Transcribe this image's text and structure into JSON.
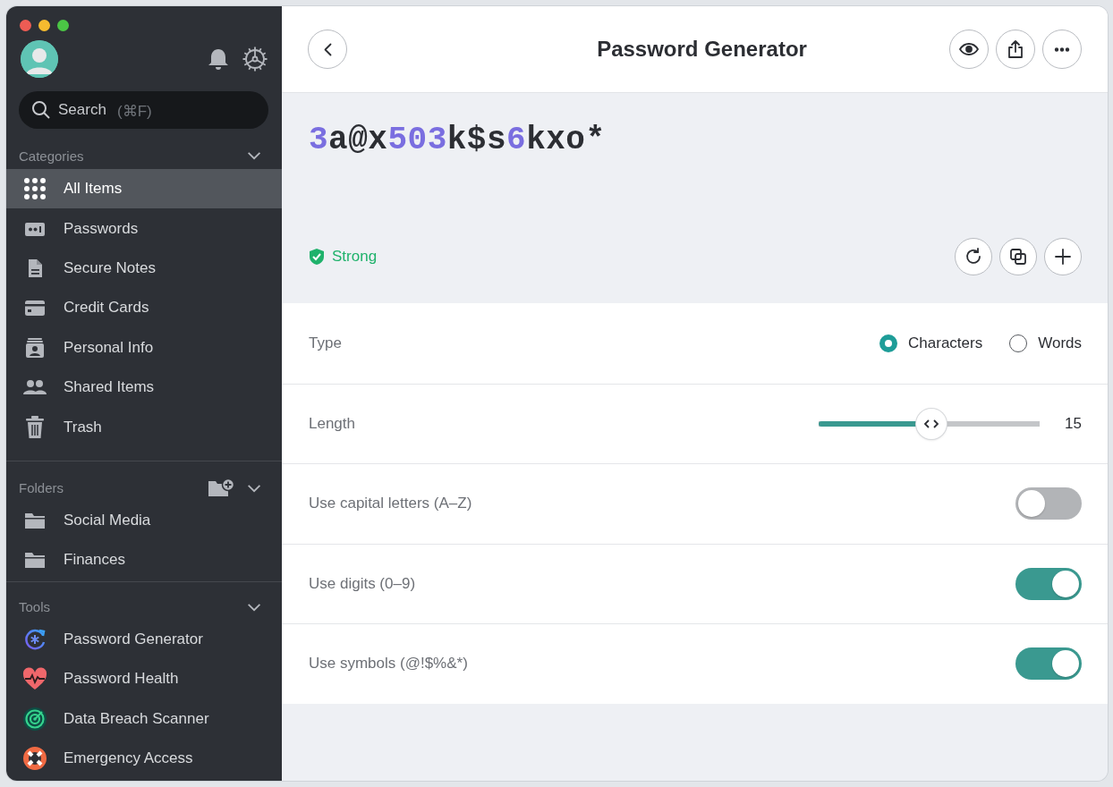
{
  "sidebar": {
    "search": {
      "placeholder": "Search",
      "shortcut": "(⌘F)"
    },
    "sections": [
      {
        "title": "Categories",
        "expanded": true,
        "add_button": false,
        "items": [
          {
            "label": "All Items",
            "kind": "grid",
            "selected": true
          },
          {
            "label": "Passwords",
            "kind": "password",
            "selected": false
          },
          {
            "label": "Secure Notes",
            "kind": "note",
            "selected": false
          },
          {
            "label": "Credit Cards",
            "kind": "card",
            "selected": false
          },
          {
            "label": "Personal Info",
            "kind": "person",
            "selected": false
          },
          {
            "label": "Shared Items",
            "kind": "people",
            "selected": false
          },
          {
            "label": "Trash",
            "kind": "trash",
            "selected": false
          }
        ]
      },
      {
        "title": "Folders",
        "expanded": true,
        "add_button": true,
        "items": [
          {
            "label": "Social Media",
            "kind": "folder",
            "selected": false
          },
          {
            "label": "Finances",
            "kind": "folder",
            "selected": false
          }
        ]
      },
      {
        "title": "Tools",
        "expanded": true,
        "add_button": false,
        "items": [
          {
            "label": "Password Generator",
            "kind": "generator",
            "selected": false
          },
          {
            "label": "Password Health",
            "kind": "health",
            "selected": false
          },
          {
            "label": "Data Breach Scanner",
            "kind": "scanner",
            "selected": false
          },
          {
            "label": "Emergency Access",
            "kind": "lifebuoy",
            "selected": false
          }
        ]
      }
    ]
  },
  "header": {
    "title": "Password Generator"
  },
  "generator": {
    "password": [
      {
        "text": "3",
        "kind": "digit"
      },
      {
        "text": "a@x",
        "kind": "other"
      },
      {
        "text": "503",
        "kind": "digit"
      },
      {
        "text": "k$s",
        "kind": "other"
      },
      {
        "text": "6",
        "kind": "digit"
      },
      {
        "text": "kxo*",
        "kind": "other"
      }
    ],
    "strength": {
      "label": "Strong",
      "color": "#1fb26b"
    }
  },
  "rows": [
    {
      "kind": "radio",
      "label": "Type",
      "options": [
        {
          "label": "Characters",
          "selected": true
        },
        {
          "label": "Words",
          "selected": false
        }
      ]
    },
    {
      "kind": "slider",
      "label": "Length",
      "level": 0.51,
      "reading": "15"
    },
    {
      "kind": "toggle",
      "label": "Use capital letters (A–Z)",
      "on": false
    },
    {
      "kind": "toggle",
      "label": "Use digits (0–9)",
      "on": true
    },
    {
      "kind": "toggle",
      "label": "Use symbols (@!$%&*)",
      "on": true
    }
  ]
}
